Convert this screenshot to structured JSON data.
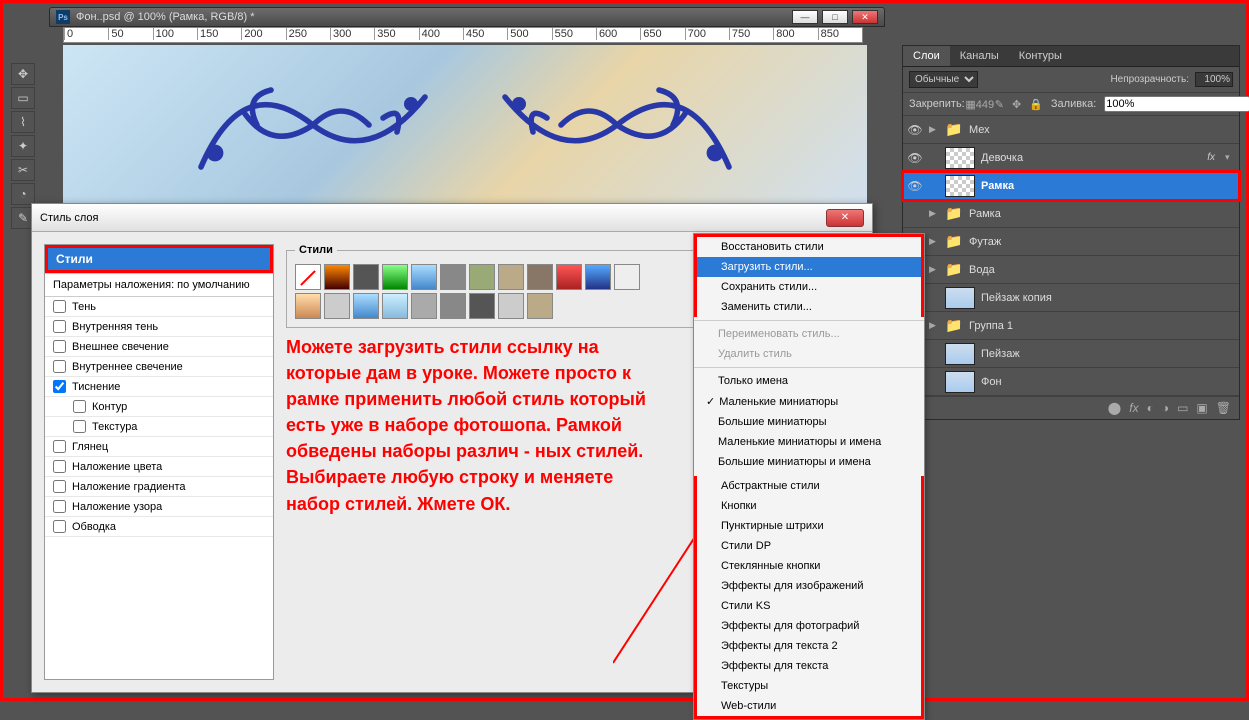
{
  "doc": {
    "title": "Фон..psd @ 100% (Рамка, RGB/8) *"
  },
  "ruler": [
    "0",
    "50",
    "100",
    "150",
    "200",
    "250",
    "300",
    "350",
    "400",
    "450",
    "500",
    "550",
    "600",
    "650",
    "700",
    "750",
    "800",
    "850"
  ],
  "dialog": {
    "title": "Стиль слоя",
    "styles_header": "Стили",
    "params": "Параметры наложения: по умолчанию",
    "effects": [
      {
        "label": "Тень",
        "checked": false,
        "indent": false
      },
      {
        "label": "Внутренняя тень",
        "checked": false,
        "indent": false
      },
      {
        "label": "Внешнее свечение",
        "checked": false,
        "indent": false
      },
      {
        "label": "Внутреннее свечение",
        "checked": false,
        "indent": false
      },
      {
        "label": "Тиснение",
        "checked": true,
        "indent": false
      },
      {
        "label": "Контур",
        "checked": false,
        "indent": true
      },
      {
        "label": "Текстура",
        "checked": false,
        "indent": true
      },
      {
        "label": "Глянец",
        "checked": false,
        "indent": false
      },
      {
        "label": "Наложение цвета",
        "checked": false,
        "indent": false
      },
      {
        "label": "Наложение градиента",
        "checked": false,
        "indent": false
      },
      {
        "label": "Наложение узора",
        "checked": false,
        "indent": false
      },
      {
        "label": "Обводка",
        "checked": false,
        "indent": false
      }
    ],
    "styles_legend": "Стили"
  },
  "red_instruction": "Можете загрузить стили ссылку на которые дам в уроке. Можете просто к рамке применить любой стиль который есть уже в наборе фотошопа. Рамкой обведены наборы различ - ных стилей. Выбираете любую строку и меняете набор стилей. Жмете ОК.",
  "flyout": {
    "top": [
      "Восстановить стили",
      "Загрузить стили...",
      "Сохранить стили...",
      "Заменить стили..."
    ],
    "disabled": [
      "Переименовать стиль...",
      "Удалить стиль"
    ],
    "view": [
      "Только имена",
      "Маленькие миниатюры",
      "Большие миниатюры",
      "Маленькие миниатюры и имена",
      "Большие миниатюры и имена"
    ],
    "presets": [
      "Абстрактные стили",
      "Кнопки",
      "Пунктирные штрихи",
      "Стили DP",
      "Стеклянные кнопки",
      "Эффекты для изображений",
      "Стили KS",
      "Эффекты для фотографий",
      "Эффекты для текста 2",
      "Эффекты для текста",
      "Текстуры",
      "Web-стили"
    ]
  },
  "panels": {
    "tabs": [
      "Слои",
      "Каналы",
      "Контуры"
    ],
    "blend_mode": "Обычные",
    "opacity_label": "Непрозрачность:",
    "opacity": "100%",
    "lock_label": "Закрепить:",
    "fill_label": "Заливка:",
    "fill": "100%",
    "layers": [
      {
        "type": "folder",
        "name": "Мех",
        "eye": true,
        "chev": true
      },
      {
        "type": "layer",
        "name": "Девочка",
        "eye": true,
        "fx": true,
        "thumb": "checker"
      },
      {
        "type": "layer",
        "name": "Рамка",
        "eye": true,
        "active": true,
        "hl": true,
        "thumb": "checker"
      },
      {
        "type": "folder",
        "name": "Рамка",
        "eye": false,
        "chev": true
      },
      {
        "type": "folder",
        "name": "Футаж",
        "eye": true,
        "chev": true
      },
      {
        "type": "folder",
        "name": "Вода",
        "eye": true,
        "chev": true
      },
      {
        "type": "layer",
        "name": "Пейзаж копия",
        "eye": true,
        "thumb": "winter"
      },
      {
        "type": "folder",
        "name": "Группа 1",
        "eye": true,
        "chev": true
      },
      {
        "type": "layer",
        "name": "Пейзаж",
        "eye": true,
        "thumb": "winter"
      },
      {
        "type": "layer",
        "name": "Фон",
        "eye": true,
        "thumb": "winter"
      }
    ]
  },
  "fx_label": "fx"
}
